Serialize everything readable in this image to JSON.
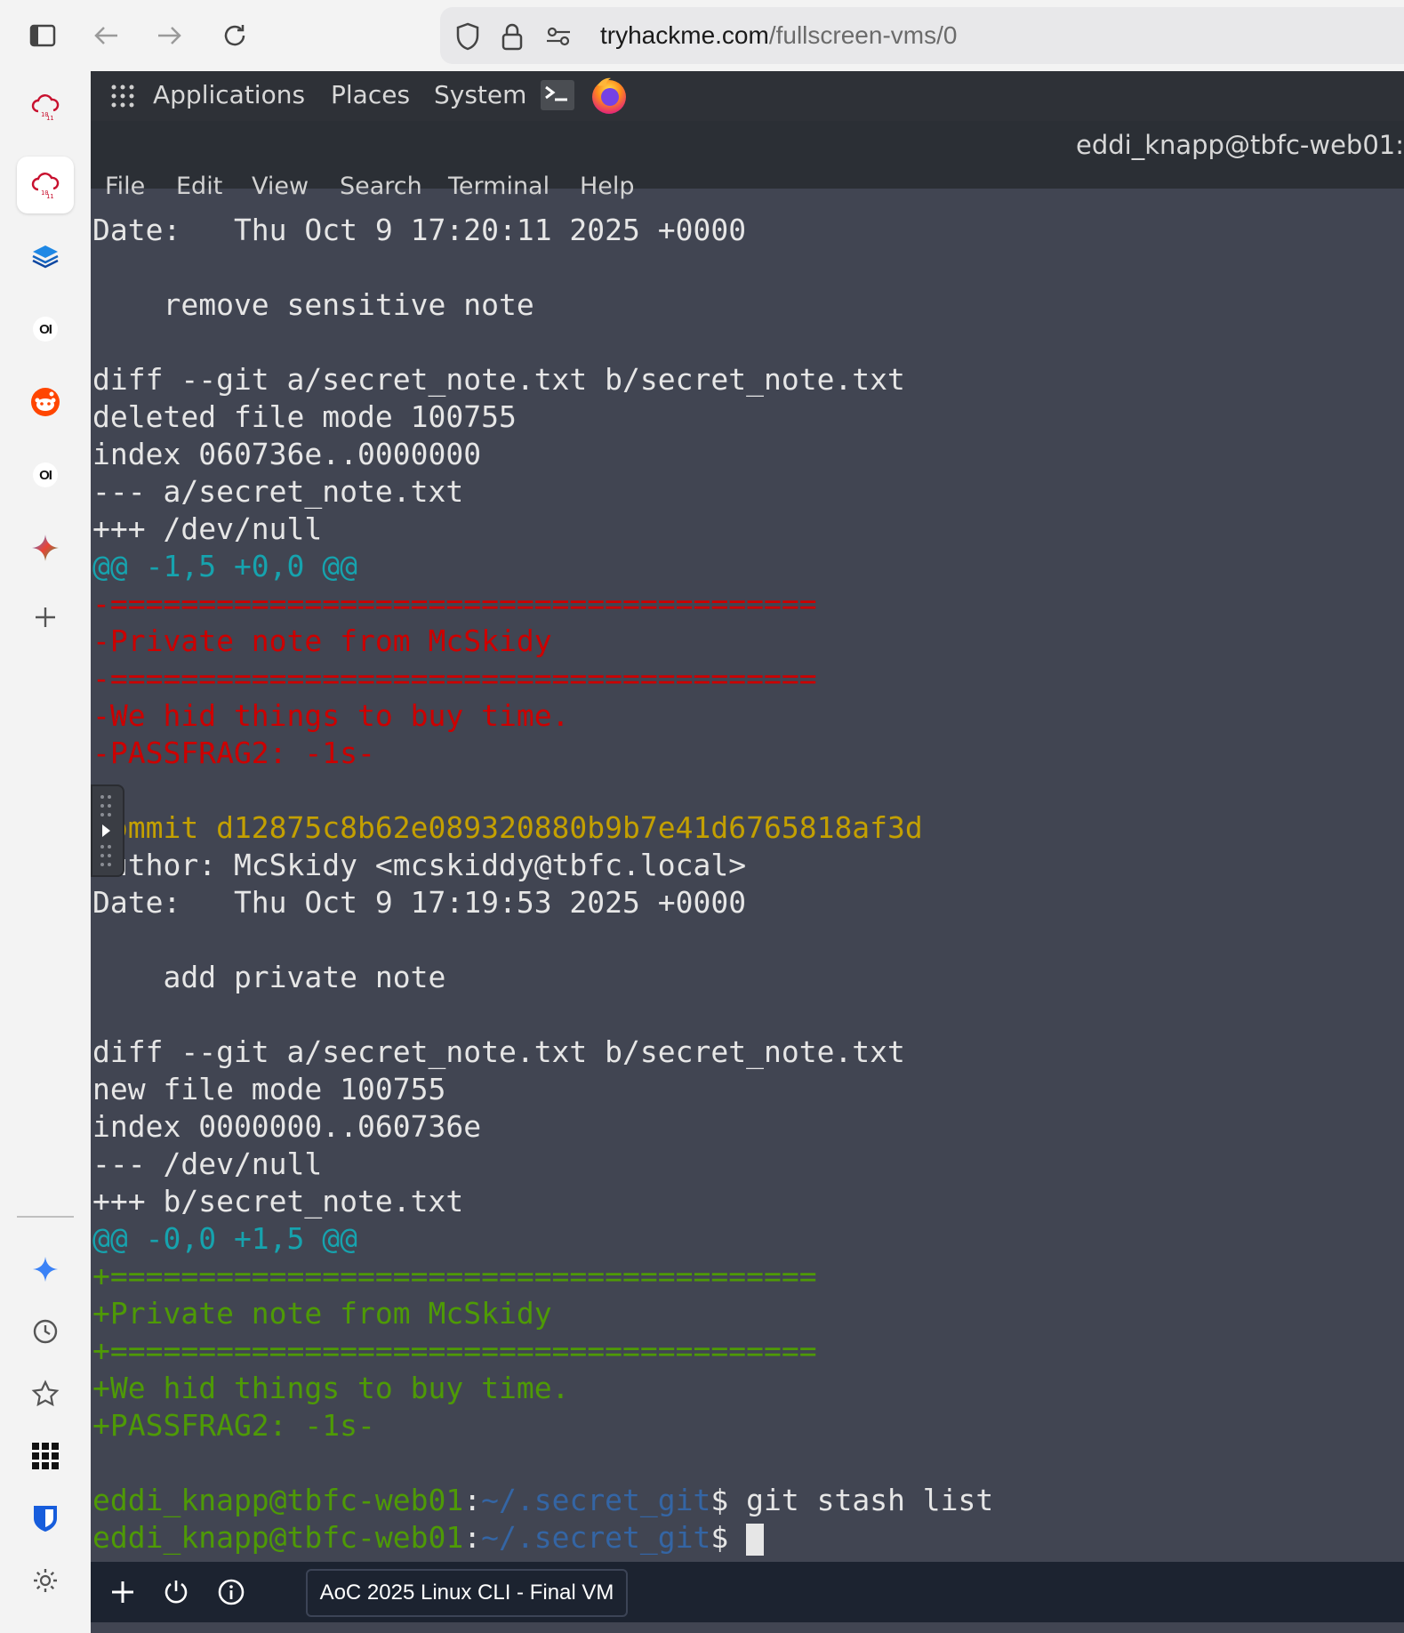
{
  "browser": {
    "url_domain": "tryhackme.com",
    "url_path": "/fullscreen-vms/0"
  },
  "sidebar": {
    "items": [
      {
        "icon": "tryhackme-cloud-icon"
      },
      {
        "icon": "tryhackme-cloud-icon",
        "active": true
      },
      {
        "icon": "stack-icon"
      },
      {
        "icon": "ol-icon",
        "label": "OI"
      },
      {
        "icon": "reddit-icon"
      },
      {
        "icon": "ol-icon",
        "label": "OI"
      },
      {
        "icon": "gemini-icon"
      },
      {
        "icon": "plus-icon"
      }
    ],
    "bottom_items": [
      "gemini-icon",
      "history-icon",
      "favorites-icon",
      "apps-icon",
      "bitwarden-icon",
      "settings-icon"
    ]
  },
  "gnome_panel": {
    "applications": "Applications",
    "places": "Places",
    "system": "System"
  },
  "terminal_window": {
    "title": "eddi_knapp@tbfc-web01:",
    "menu": [
      "File",
      "Edit",
      "View",
      "Search",
      "Terminal",
      "Help"
    ]
  },
  "terminal": {
    "lines": [
      {
        "color": "white",
        "text": "Date:   Thu Oct 9 17:20:11 2025 +0000"
      },
      {
        "color": "white",
        "text": ""
      },
      {
        "color": "white",
        "text": "    remove sensitive note"
      },
      {
        "color": "white",
        "text": ""
      },
      {
        "color": "white",
        "text": "diff --git a/secret_note.txt b/secret_note.txt"
      },
      {
        "color": "white",
        "text": "deleted file mode 100755"
      },
      {
        "color": "white",
        "text": "index 060736e..0000000"
      },
      {
        "color": "white",
        "text": "--- a/secret_note.txt"
      },
      {
        "color": "white",
        "text": "+++ /dev/null"
      },
      {
        "color": "cyan",
        "text": "@@ -1,5 +0,0 @@"
      },
      {
        "color": "red",
        "text": "-========================================"
      },
      {
        "color": "red",
        "text": "-Private note from McSkidy"
      },
      {
        "color": "red",
        "text": "-========================================"
      },
      {
        "color": "red",
        "text": "-We hid things to buy time."
      },
      {
        "color": "red",
        "text": "-PASSFRAG2: -1s-"
      },
      {
        "color": "white",
        "text": ""
      },
      {
        "color": "yellow",
        "text": "commit d12875c8b62e089320880b9b7e41d6765818af3d"
      },
      {
        "color": "white",
        "text": "Author: McSkidy <mcskiddy@tbfc.local>"
      },
      {
        "color": "white",
        "text": "Date:   Thu Oct 9 17:19:53 2025 +0000"
      },
      {
        "color": "white",
        "text": ""
      },
      {
        "color": "white",
        "text": "    add private note"
      },
      {
        "color": "white",
        "text": ""
      },
      {
        "color": "white",
        "text": "diff --git a/secret_note.txt b/secret_note.txt"
      },
      {
        "color": "white",
        "text": "new file mode 100755"
      },
      {
        "color": "white",
        "text": "index 0000000..060736e"
      },
      {
        "color": "white",
        "text": "--- /dev/null"
      },
      {
        "color": "white",
        "text": "+++ b/secret_note.txt"
      },
      {
        "color": "cyan",
        "text": "@@ -0,0 +1,5 @@"
      },
      {
        "color": "green",
        "text": "+========================================"
      },
      {
        "color": "green",
        "text": "+Private note from McSkidy"
      },
      {
        "color": "green",
        "text": "+========================================"
      },
      {
        "color": "green",
        "text": "+We hid things to buy time."
      },
      {
        "color": "green",
        "text": "+PASSFRAG2: -1s-"
      },
      {
        "color": "white",
        "text": ""
      }
    ],
    "prompt_user": "eddi_knapp@tbfc-web01",
    "prompt_sep": ":",
    "prompt_path": "~/.secret_git",
    "prompt_symbol": "$",
    "cmd1": " git stash list",
    "cmd2": " "
  },
  "bottom_bar": {
    "vm_name": "AoC 2025 Linux CLI - Final VM"
  },
  "colors": {
    "terminal_bg": "#414552",
    "red": "#cc0000",
    "green": "#4e9a06",
    "cyan": "#16a3ae",
    "yellow": "#c4a000"
  }
}
